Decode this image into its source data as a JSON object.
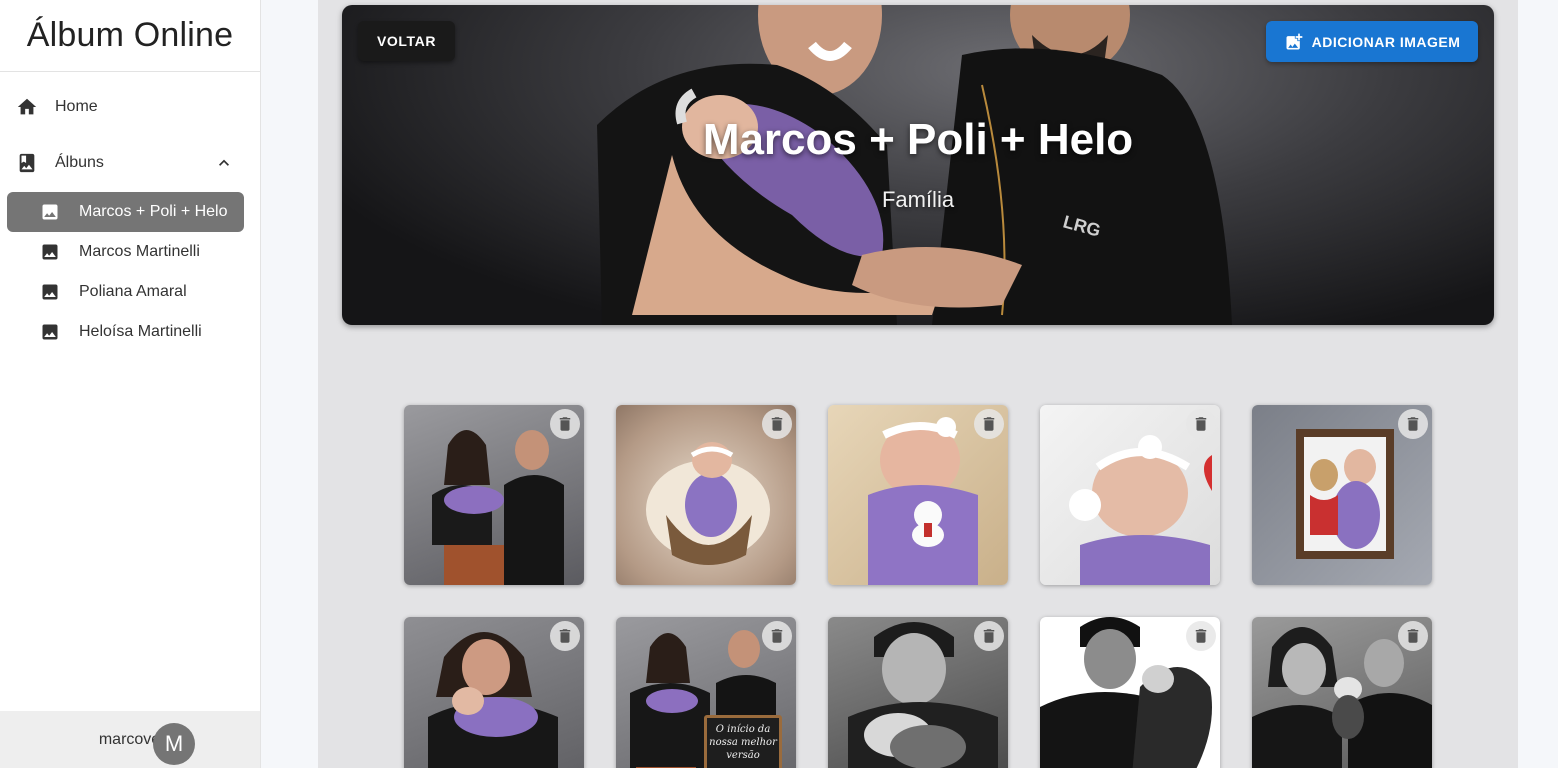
{
  "app": {
    "title": "Álbum Online"
  },
  "nav": {
    "home": "Home",
    "albums": "Álbuns",
    "album_items": [
      {
        "label": "Marcos + Poli + Helo",
        "active": true
      },
      {
        "label": "Marcos Martinelli",
        "active": false
      },
      {
        "label": "Poliana Amaral",
        "active": false
      },
      {
        "label": "Heloísa Martinelli",
        "active": false
      }
    ]
  },
  "user": {
    "name": "marcoveioofc",
    "initial": "M"
  },
  "album": {
    "title": "Marcos + Poli + Helo",
    "category": "Família",
    "back_label": "VOLTAR",
    "add_label": "ADICIONAR IMAGEM"
  },
  "chalkboard_text": "O início da nossa melhor versão",
  "photos": [
    {
      "subject": "family-portrait"
    },
    {
      "subject": "baby-in-basket"
    },
    {
      "subject": "baby-with-bear"
    },
    {
      "subject": "baby-sleeping-bow"
    },
    {
      "subject": "baby-in-crib"
    },
    {
      "subject": "mother-holding-baby"
    },
    {
      "subject": "family-chalkboard"
    },
    {
      "subject": "father-kissing-baby"
    },
    {
      "subject": "father-holding-baby-bw"
    },
    {
      "subject": "family-kiss-bw"
    }
  ],
  "colors": {
    "accent": "#1976d2",
    "active_item": "#757575",
    "panel": "#e3e3e5"
  },
  "icons": {
    "home": "home-icon",
    "album": "album-book-icon",
    "image": "image-icon",
    "add": "add-photo-icon",
    "delete": "trash-icon",
    "collapse": "chevron-up-icon"
  }
}
